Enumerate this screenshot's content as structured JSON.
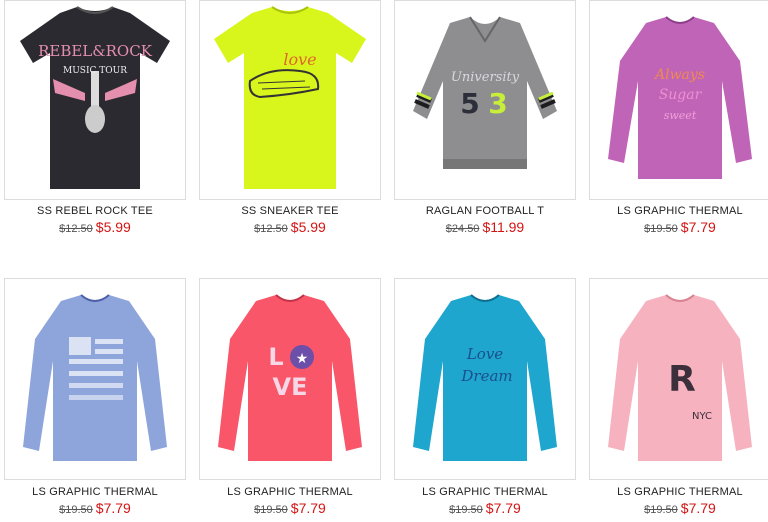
{
  "products": [
    {
      "name": "SS REBEL ROCK TEE",
      "orig": "$12.50",
      "sale": "$5.99",
      "color": "#2b2a30",
      "graphic": "REBEL & ROCK"
    },
    {
      "name": "SS SNEAKER TEE",
      "orig": "$12.50",
      "sale": "$5.99",
      "color": "#d8f51c",
      "graphic": "love"
    },
    {
      "name": "RAGLAN FOOTBALL T",
      "orig": "$24.50",
      "sale": "$11.99",
      "color": "#8e8e90",
      "graphic": "University 53"
    },
    {
      "name": "LS GRAPHIC THERMAL",
      "orig": "$19.50",
      "sale": "$7.79",
      "color": "#c064b8",
      "graphic": "Sugar"
    },
    {
      "name": "LS GRAPHIC THERMAL",
      "orig": "$19.50",
      "sale": "$7.79",
      "color": "#8ea5db",
      "graphic": "flag"
    },
    {
      "name": "LS GRAPHIC THERMAL",
      "orig": "$19.50",
      "sale": "$7.79",
      "color": "#f9566a",
      "graphic": "LOVE"
    },
    {
      "name": "LS GRAPHIC THERMAL",
      "orig": "$19.50",
      "sale": "$7.79",
      "color": "#1ea6cf",
      "graphic": "Love Dream"
    },
    {
      "name": "LS GRAPHIC THERMAL",
      "orig": "$19.50",
      "sale": "$7.79",
      "color": "#f6b3bf",
      "graphic": "R NYC"
    }
  ]
}
